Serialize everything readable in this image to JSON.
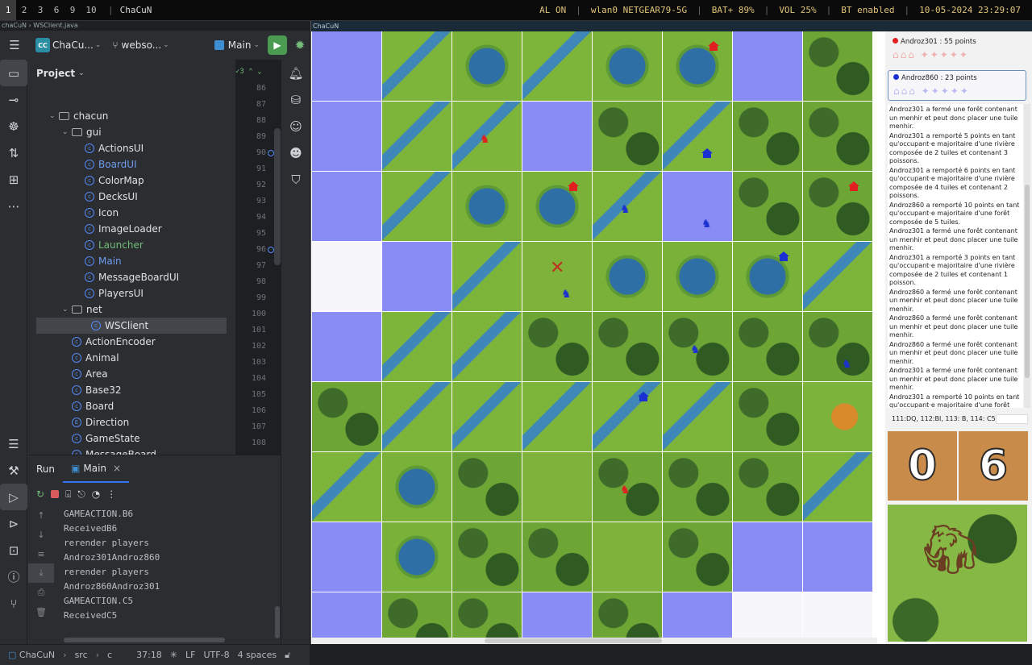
{
  "topbar": {
    "workspaces": [
      "1",
      "2",
      "3",
      "6",
      "9",
      "10"
    ],
    "active_workspace": "1",
    "window_title": "ChaCuN",
    "status": [
      "AL ON",
      "wlan0 NETGEAR79-5G",
      "BAT+ 89%",
      "VOL 25%",
      "BT enabled",
      "10-05-2024 23:29:07"
    ]
  },
  "ide": {
    "breadcrumb": "chaCuN › WSClient.java",
    "toolbar": {
      "project_badge": "CC",
      "project_name": "ChaCu...",
      "branch": "webso...",
      "run_config": "Main"
    },
    "project_panel": {
      "title": "Project",
      "tree": [
        {
          "label": "chacun",
          "kind": "folder",
          "indent": 1,
          "color": "#dfe1e5"
        },
        {
          "label": "gui",
          "kind": "folder",
          "indent": 2,
          "color": "#dfe1e5"
        },
        {
          "label": "ActionsUI",
          "kind": "class",
          "indent": 3,
          "color": "#dfe1e5"
        },
        {
          "label": "BoardUI",
          "kind": "class",
          "indent": 3,
          "color": "#6f9cf0"
        },
        {
          "label": "ColorMap",
          "kind": "class",
          "indent": 3,
          "color": "#dfe1e5"
        },
        {
          "label": "DecksUI",
          "kind": "class",
          "indent": 3,
          "color": "#dfe1e5"
        },
        {
          "label": "Icon",
          "kind": "class",
          "indent": 3,
          "color": "#dfe1e5"
        },
        {
          "label": "ImageLoader",
          "kind": "class",
          "indent": 3,
          "color": "#dfe1e5"
        },
        {
          "label": "Launcher",
          "kind": "class",
          "indent": 3,
          "color": "#73bd79"
        },
        {
          "label": "Main",
          "kind": "class",
          "indent": 3,
          "color": "#6f9cf0"
        },
        {
          "label": "MessageBoardUI",
          "kind": "class",
          "indent": 3,
          "color": "#dfe1e5"
        },
        {
          "label": "PlayersUI",
          "kind": "class",
          "indent": 3,
          "color": "#dfe1e5"
        },
        {
          "label": "net",
          "kind": "folder",
          "indent": 2,
          "color": "#dfe1e5"
        },
        {
          "label": "WSClient",
          "kind": "class",
          "indent": 3,
          "color": "#dfe1e5",
          "selected": true
        },
        {
          "label": "ActionEncoder",
          "kind": "class",
          "indent": 2,
          "color": "#dfe1e5"
        },
        {
          "label": "Animal",
          "kind": "class",
          "indent": 2,
          "color": "#dfe1e5"
        },
        {
          "label": "Area",
          "kind": "class",
          "indent": 2,
          "color": "#dfe1e5"
        },
        {
          "label": "Base32",
          "kind": "class",
          "indent": 2,
          "color": "#dfe1e5"
        },
        {
          "label": "Board",
          "kind": "class",
          "indent": 2,
          "color": "#dfe1e5"
        },
        {
          "label": "Direction",
          "kind": "enum",
          "indent": 2,
          "color": "#dfe1e5"
        },
        {
          "label": "GameState",
          "kind": "class",
          "indent": 2,
          "color": "#dfe1e5"
        },
        {
          "label": "MessageBoard",
          "kind": "class",
          "indent": 2,
          "color": "#dfe1e5"
        }
      ]
    },
    "gutter": {
      "warning_count": "3",
      "lines": [
        "86",
        "87",
        "88",
        "89",
        "90",
        "91",
        "92",
        "93",
        "94",
        "95",
        "96",
        "97",
        "98",
        "99",
        "100",
        "101",
        "102",
        "103",
        "104",
        "105",
        "106",
        "107",
        "108"
      ],
      "marked": [
        "90",
        "96"
      ]
    },
    "run_panel": {
      "tabs": [
        "Run",
        "Main"
      ],
      "console": [
        "GAMEACTION.B6",
        "ReceivedB6",
        "rerender players",
        "Androz301Androz860",
        "rerender players",
        "Androz860Androz301",
        "GAMEACTION.C5",
        "ReceivedC5"
      ]
    },
    "statusbar": {
      "project": "ChaCuN",
      "path1": "src",
      "path2": "c",
      "position": "37:18",
      "line_sep": "LF",
      "encoding": "UTF-8",
      "indent": "4 spaces"
    }
  },
  "game": {
    "title": "ChaCuN",
    "players": [
      {
        "name": "Androz301",
        "points": "Androz301 : 55 points",
        "color": "#e02020",
        "active": false
      },
      {
        "name": "Androz860",
        "points": "Androz860 : 23 points",
        "color": "#1a30d0",
        "active": true
      }
    ],
    "log": [
      "Androz301 a fermé une forêt contenant un menhir et peut donc placer une tuile menhir.",
      "Androz301 a remporté 5 points en tant qu'occupant·e majoritaire d'une rivière composée de 2 tuiles et contenant 3 poissons.",
      "Androz301 a remporté 6 points en tant qu'occupant·e majoritaire d'une rivière composée de 4 tuiles et contenant 2 poissons.",
      "Androz860 a remporté 10 points en tant qu'occupant·e majoritaire d'une forêt composée de 5 tuiles.",
      "Androz301 a fermé une forêt contenant un menhir et peut donc placer une tuile menhir.",
      "Androz301 a remporté 3 points en tant qu'occupant·e majoritaire d'une rivière composée de 2 tuiles et contenant 1 poisson.",
      "Androz860 a fermé une forêt contenant un menhir et peut donc placer une tuile menhir.",
      "Androz860 a fermé une forêt contenant un menhir et peut donc placer une tuile menhir.",
      "Androz860 a fermé une forêt contenant un menhir et peut donc placer une tuile menhir.",
      "Androz301 a fermé une forêt contenant un menhir et peut donc placer une tuile menhir.",
      "Androz301 a remporté 10 points en tant qu'occupant·e majoritaire d'une forêt composée de 5 tuiles.",
      "Androz301 a fermé une forêt contenant un menhir et peut donc placer une tuile menhir.",
      "Androz860 a fermé une forêt contenant un menhir et peut donc placer une tuile menhir."
    ],
    "occupants_hint": "111:DQ, 112:BI, 113: B, 114: C5",
    "deck_counts": [
      "0",
      "6"
    ],
    "board_rows": [
      [
        "empty",
        "river",
        "lake",
        "river",
        "lake",
        "lake",
        "empty",
        "forest"
      ],
      [
        "empty",
        "river",
        "river",
        "empty",
        "forest",
        "river",
        "forest",
        "forest"
      ],
      [
        "empty",
        "river",
        "lake",
        "lake",
        "river",
        "empty",
        "forest",
        "forest"
      ],
      [
        "white",
        "empty",
        "river",
        "grass",
        "lake",
        "lake",
        "lake",
        "river"
      ],
      [
        "empty",
        "river",
        "river",
        "forest",
        "forest",
        "forest",
        "forest",
        "forest"
      ],
      [
        "forest",
        "river",
        "river",
        "river",
        "river",
        "river",
        "forest",
        "fire"
      ],
      [
        "river",
        "lake",
        "forest",
        "grass",
        "forest",
        "forest",
        "forest",
        "river"
      ],
      [
        "empty",
        "lake",
        "forest",
        "forest",
        "grass",
        "forest",
        "empty",
        "empty"
      ],
      [
        "empty",
        "forest",
        "forest",
        "empty",
        "forest",
        "empty",
        "white",
        "white"
      ]
    ],
    "pawns": [
      {
        "row": 0,
        "col": 5,
        "type": "hut",
        "color": "#e02020"
      },
      {
        "row": 1,
        "col": 2,
        "type": "pawn",
        "color": "#e02020"
      },
      {
        "row": 1,
        "col": 5,
        "type": "hut",
        "color": "#1a30d0"
      },
      {
        "row": 2,
        "col": 3,
        "type": "hut",
        "color": "#e02020"
      },
      {
        "row": 2,
        "col": 4,
        "type": "pawn",
        "color": "#1a30d0"
      },
      {
        "row": 2,
        "col": 5,
        "type": "pawn",
        "color": "#1a30d0"
      },
      {
        "row": 2,
        "col": 7,
        "type": "hut",
        "color": "#e02020"
      },
      {
        "row": 2,
        "col": 8,
        "type": "pawn",
        "color": "#e02020"
      },
      {
        "row": 3,
        "col": 3,
        "type": "pawn",
        "color": "#1a30d0"
      },
      {
        "row": 3,
        "col": 6,
        "type": "hut",
        "color": "#1a30d0"
      },
      {
        "row": 4,
        "col": 5,
        "type": "pawn",
        "color": "#1a30d0"
      },
      {
        "row": 4,
        "col": 7,
        "type": "pawn",
        "color": "#1a30d0"
      },
      {
        "row": 5,
        "col": 4,
        "type": "hut",
        "color": "#1a30d0"
      },
      {
        "row": 6,
        "col": 4,
        "type": "pawn",
        "color": "#e02020"
      }
    ],
    "cancel_marker": {
      "row": 3,
      "col": 3,
      "color": "#c03020"
    }
  }
}
